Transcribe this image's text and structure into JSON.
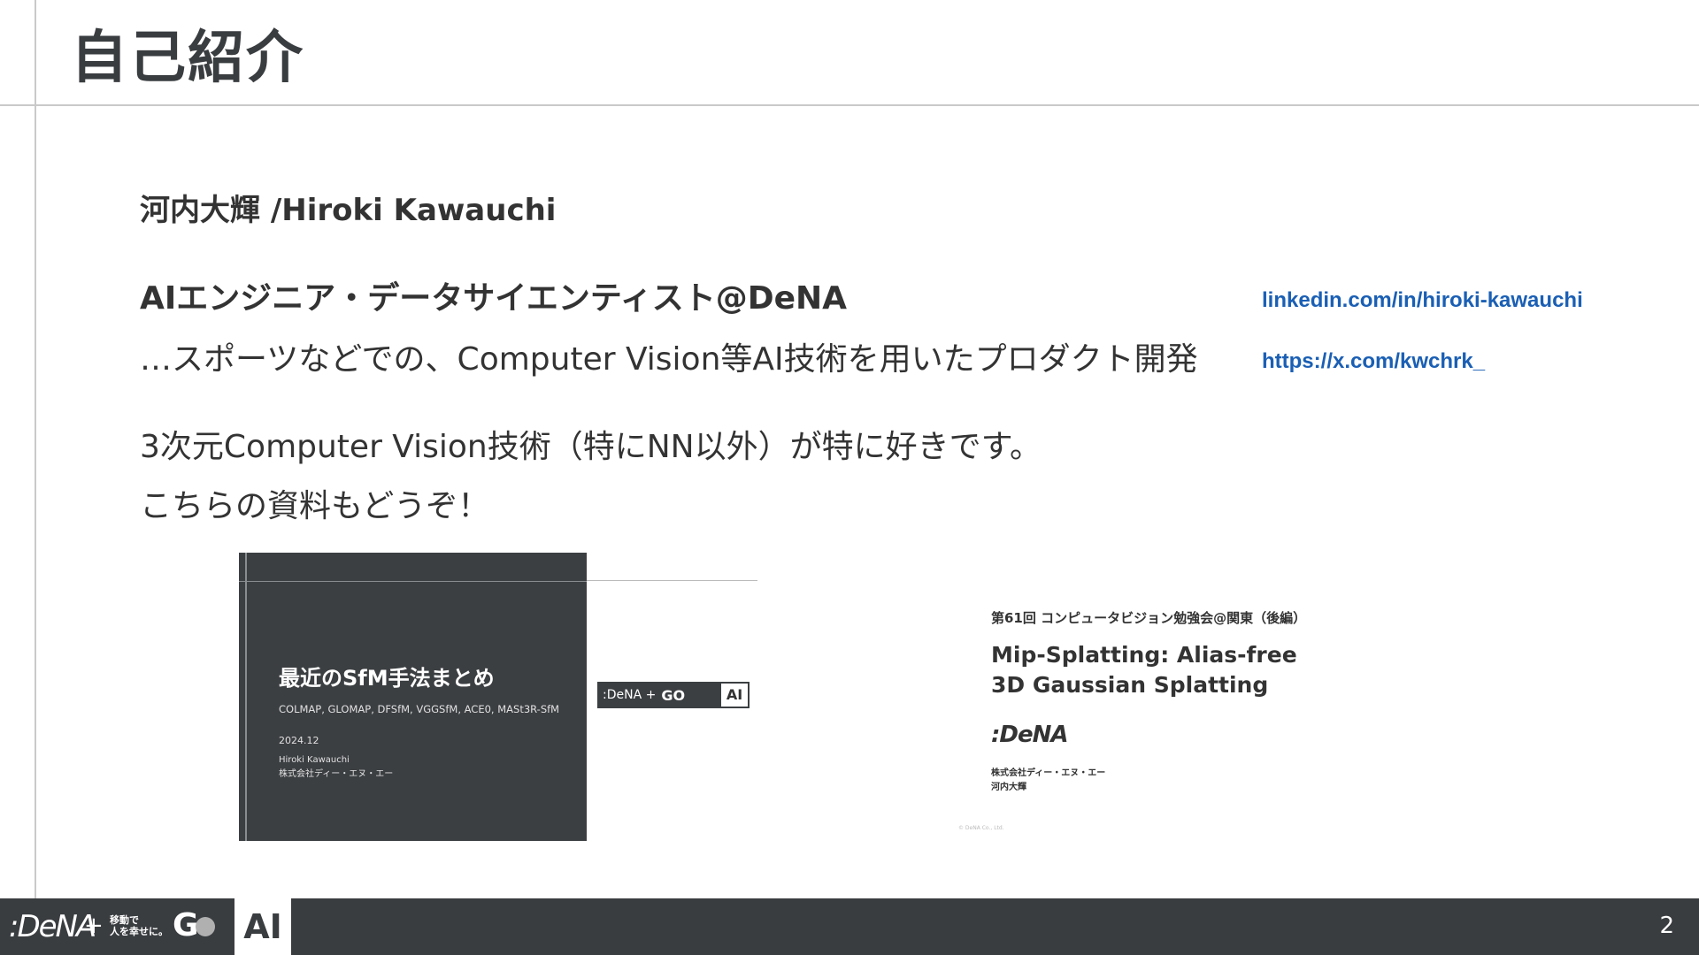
{
  "slide": {
    "title": "自己紹介",
    "name": "河内大輝 /Hiroki Kawauchi",
    "role": "AIエンジニア・データサイエンティスト@DeNA",
    "description": "…スポーツなどでの、Computer Vision等AI技術を用いたプロダクト開発",
    "interest": "3次元Computer Vision技術（特にNN以外）が特に好きです。",
    "materials_intro": "こちらの資料もどうぞ！",
    "page_number": "2"
  },
  "links": {
    "linkedin": "linkedin.com/in/hiroki-kawauchi",
    "x": "https://x.com/kwchrk_"
  },
  "thumb1": {
    "title": "最近のSfM手法まとめ",
    "subtitle": "COLMAP, GLOMAP, DFSfM, VGGSfM, ACE0, MASt3R-SfM",
    "date": "2024.12",
    "author": "Hiroki Kawauchi",
    "company": "株式会社ディー・エヌ・エー",
    "badge_logo": ":DeNA +",
    "badge_go": "GO",
    "badge_ai": "AI"
  },
  "thumb2": {
    "event": "第61回 コンピュータビジョン勉強会@関東（後編）",
    "title_line1": "Mip-Splatting: Alias-free",
    "title_line2": "3D Gaussian Splatting",
    "logo": ":DeNA",
    "company": "株式会社ディー・エヌ・エー",
    "author": "河内大輝",
    "copyright": "© DeNA Co., Ltd."
  },
  "footer": {
    "logo": ":DeNA",
    "plus": "+",
    "slogan_line1": "移動で",
    "slogan_line2": "人を幸せに。",
    "go": "G",
    "ai": "AI"
  }
}
